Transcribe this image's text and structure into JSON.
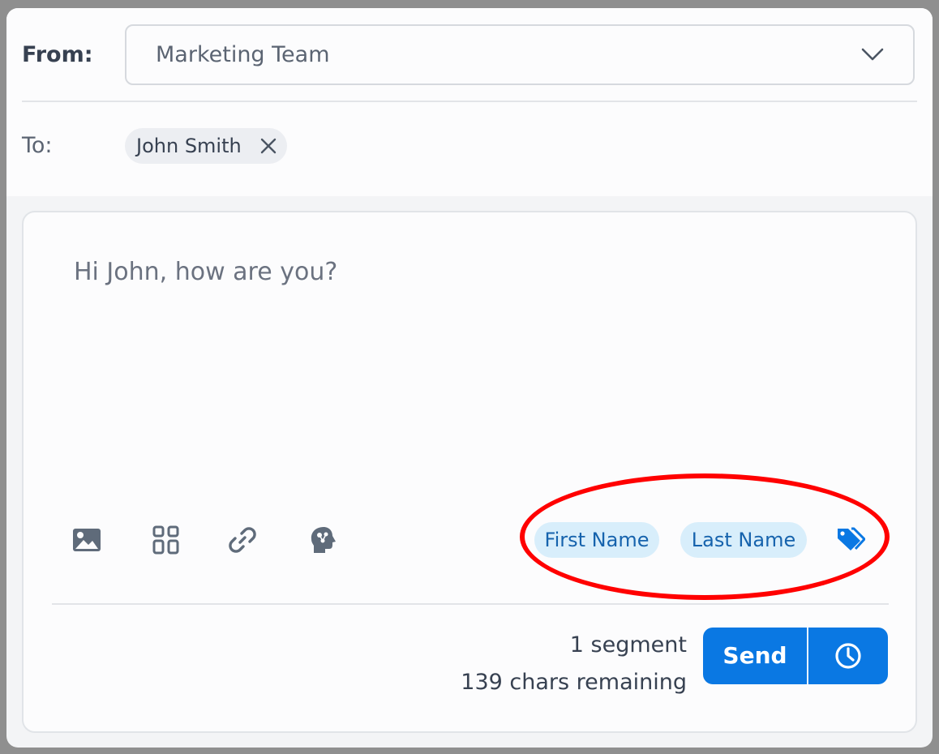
{
  "compose": {
    "from_label": "From:",
    "from_value": "Marketing Team",
    "to_label": "To:",
    "recipient": "John Smith",
    "message": "Hi John, how are you?"
  },
  "toolbar": {
    "icons": [
      "image-icon",
      "template-grid-icon",
      "link-icon",
      "ai-brain-icon"
    ],
    "tags": [
      "First Name",
      "Last Name"
    ],
    "tag_icon": "tags-icon"
  },
  "footer": {
    "segments": "1 segment",
    "remaining": "139 chars remaining",
    "send_label": "Send",
    "schedule_icon": "clock-icon"
  },
  "colors": {
    "accent": "#0a78e3",
    "tag_bg": "#d8eefb",
    "tag_text": "#1663ad",
    "highlight": "#ff0000"
  }
}
